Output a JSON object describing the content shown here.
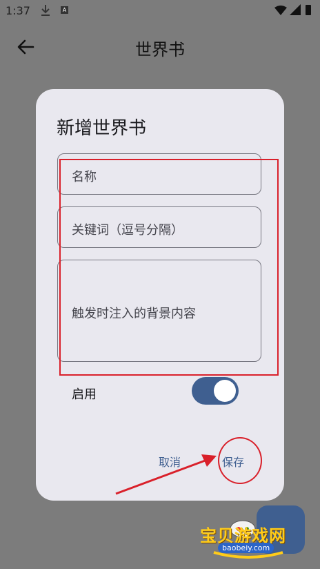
{
  "status_bar": {
    "time": "1:37",
    "icons": [
      "download-icon",
      "a-icon",
      "wifi-icon",
      "signal-icon",
      "battery-icon"
    ]
  },
  "app_bar": {
    "title": "世界书",
    "back_icon": "arrow-left-icon"
  },
  "dialog": {
    "title": "新增世界书",
    "fields": {
      "name_placeholder": "名称",
      "keywords_placeholder": "关键词（逗号分隔）",
      "content_placeholder": "触发时注入的背景内容"
    },
    "enable_label": "启用",
    "enable_on": true,
    "cancel_label": "取消",
    "save_label": "保存"
  },
  "watermark": {
    "text": "宝贝游戏网",
    "url": "baobeiy.com"
  },
  "colors": {
    "accent": "#3f5f90",
    "annotation": "#d9202a",
    "dialog_bg": "#e9e8ef",
    "scrim": "#7c7c7c"
  }
}
